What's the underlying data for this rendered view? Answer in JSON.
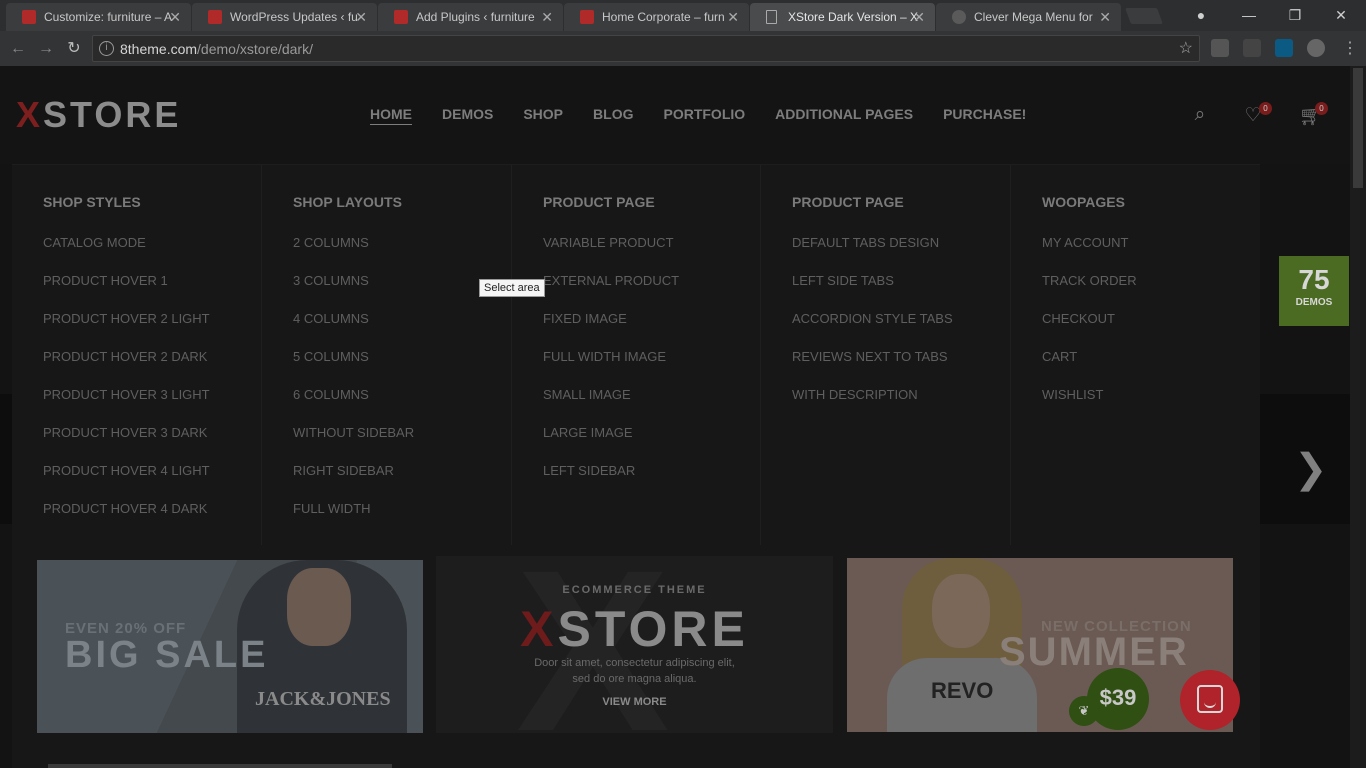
{
  "browser": {
    "tabs": [
      {
        "title": "Customize: furniture – A"
      },
      {
        "title": "WordPress Updates ‹ fu"
      },
      {
        "title": "Add Plugins ‹ furniture"
      },
      {
        "title": "Home Corporate – furn"
      },
      {
        "title": "XStore Dark Version – X",
        "active": true
      },
      {
        "title": "Clever Mega Menu for"
      }
    ],
    "url_host": "8theme.com",
    "url_path": "/demo/xstore/dark/"
  },
  "site": {
    "logo_x": "X",
    "logo_rest": "STORE",
    "nav": [
      "HOME",
      "DEMOS",
      "SHOP",
      "BLOG",
      "PORTFOLIO",
      "ADDITIONAL PAGES",
      "PURCHASE!"
    ],
    "wishlist_count": "0",
    "cart_count": "0"
  },
  "mega_menu": {
    "columns": [
      {
        "heading": "SHOP STYLES",
        "items": [
          "CATALOG MODE",
          "PRODUCT HOVER 1",
          "PRODUCT HOVER 2 LIGHT",
          "PRODUCT HOVER 2 DARK",
          "PRODUCT HOVER 3 LIGHT",
          "PRODUCT HOVER 3 DARK",
          "PRODUCT HOVER 4 LIGHT",
          "PRODUCT HOVER 4 DARK"
        ]
      },
      {
        "heading": "SHOP LAYOUTS",
        "items": [
          "2 COLUMNS",
          "3 COLUMNS",
          "4 COLUMNS",
          "5 COLUMNS",
          "6 COLUMNS",
          "WITHOUT SIDEBAR",
          "RIGHT SIDEBAR",
          "FULL WIDTH"
        ]
      },
      {
        "heading": "PRODUCT PAGE",
        "items": [
          "VARIABLE PRODUCT",
          "EXTERNAL PRODUCT",
          "FIXED IMAGE",
          "FULL WIDTH IMAGE",
          "SMALL IMAGE",
          "LARGE IMAGE",
          "LEFT SIDEBAR"
        ]
      },
      {
        "heading": "PRODUCT PAGE",
        "items": [
          "DEFAULT TABS DESIGN",
          "LEFT SIDE TABS",
          "ACCORDION STYLE TABS",
          "REVIEWS NEXT TO TABS",
          "WITH DESCRIPTION"
        ]
      },
      {
        "heading": "WOOPAGES",
        "items": [
          "MY ACCOUNT",
          "TRACK ORDER",
          "CHECKOUT",
          "CART",
          "WISHLIST"
        ]
      }
    ]
  },
  "tooltip": "Select area",
  "demos_badge": {
    "number": "75",
    "label": "DEMOS"
  },
  "banners": {
    "sale": {
      "small": "EVEN 20% OFF",
      "big": "BIG SALE",
      "shirt": "JACK&JONES"
    },
    "theme": {
      "kicker": "ECOMMERCE THEME",
      "brand_x": "X",
      "brand_rest": "STORE",
      "desc_1": "Door sit amet, consectetur adipiscing elit,",
      "desc_2": "sed do ore magna aliqua.",
      "cta": "VIEW MORE"
    },
    "summer": {
      "small": "NEW COLLECTION",
      "big": "SUMMER",
      "price": "$39",
      "top": "REVO"
    }
  }
}
